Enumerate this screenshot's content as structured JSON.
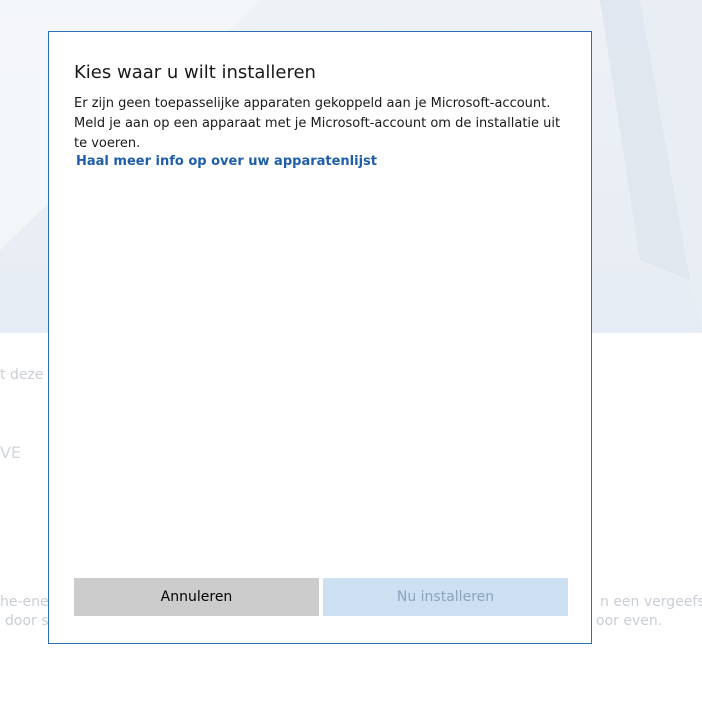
{
  "background": {
    "text_1": "t deze",
    "text_2": "VE",
    "text_3": "he-ener",
    "text_4": "door s",
    "text_5": "n een vergeefse r",
    "text_6": "oor even."
  },
  "dialog": {
    "title": "Kies waar u wilt installeren",
    "body_line_1": "Er zijn geen toepasselijke apparaten gekoppeld aan je Microsoft-account.",
    "body_line_2": "Meld je aan op een apparaat met je Microsoft-account om de installatie uit",
    "body_line_3": "te voeren.",
    "link": "Haal meer info op over uw apparatenlijst",
    "cancel_label": "Annuleren",
    "install_label": "Nu installeren"
  },
  "colors": {
    "dialog_border": "#2f6fb4",
    "link": "#1f5ea8",
    "cancel_bg": "#cccccc",
    "install_bg_disabled": "#cce0f2"
  }
}
